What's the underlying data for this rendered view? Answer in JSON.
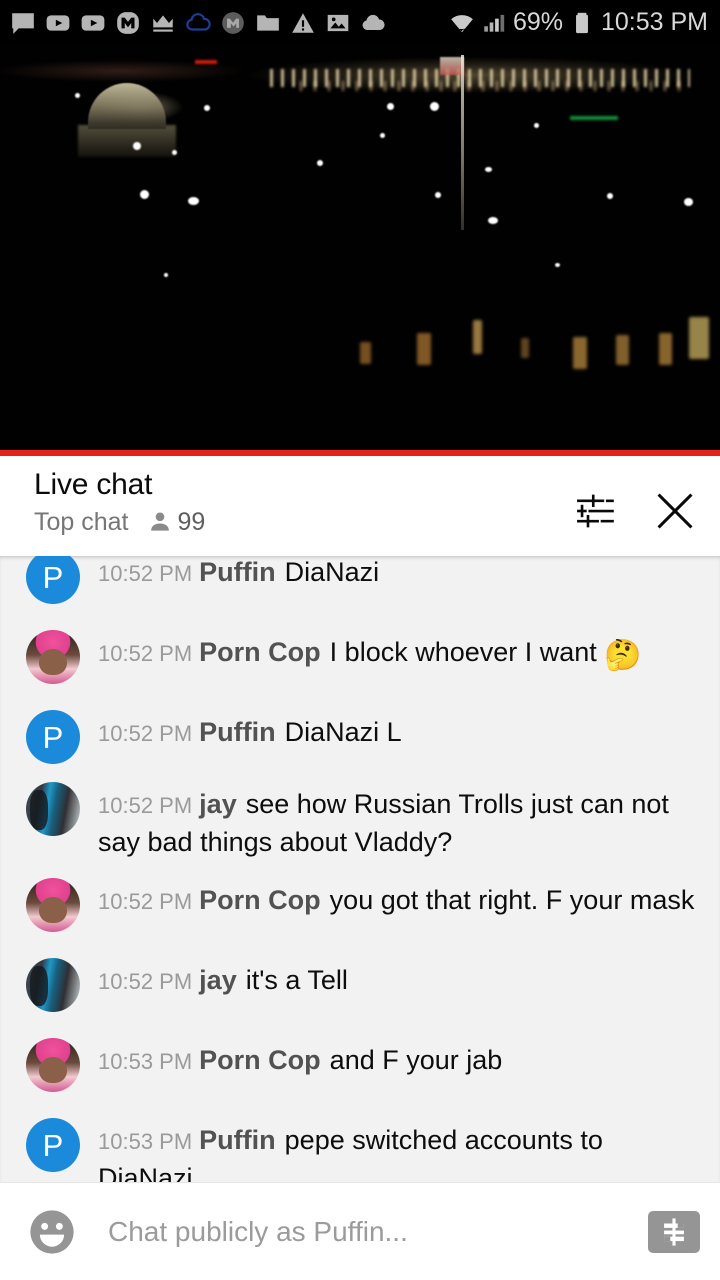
{
  "status_bar": {
    "icons": [
      "message-icon",
      "youtube-icon",
      "youtube-icon",
      "monero-icon",
      "crown-icon",
      "cloud-outline-icon",
      "monero-circle-icon",
      "folder-icon",
      "warning-triangle-icon",
      "image-icon",
      "cloud-filled-icon"
    ],
    "right_icons": [
      "wifi-icon",
      "cell-signal-icon",
      "battery-icon"
    ],
    "battery_percent": "69%",
    "clock": "10:53 PM"
  },
  "video": {
    "progress_color": "#e62117"
  },
  "chat_header": {
    "title": "Live chat",
    "subtitle": "Top chat",
    "viewer_count": "99",
    "viewer_icon": "person-icon",
    "tune_icon": "tune-icon",
    "close_icon": "close-icon"
  },
  "messages": [
    {
      "timestamp": "10:52 PM",
      "author": "Puffin",
      "text": "DiaNazi",
      "avatar_type": "letter",
      "avatar_letter": "P",
      "avatar_color": "#1c8adb",
      "emoji": ""
    },
    {
      "timestamp": "10:52 PM",
      "author": "Porn Cop",
      "text": "I block whoever I want",
      "avatar_type": "photo-porncop",
      "avatar_letter": "",
      "avatar_color": "",
      "emoji": "🤔"
    },
    {
      "timestamp": "10:52 PM",
      "author": "Puffin",
      "text": "DiaNazi L",
      "avatar_type": "letter",
      "avatar_letter": "P",
      "avatar_color": "#1c8adb",
      "emoji": ""
    },
    {
      "timestamp": "10:52 PM",
      "author": "jay",
      "text": "see how Russian Trolls just can not say bad things about Vladdy?",
      "avatar_type": "photo-jay",
      "avatar_letter": "",
      "avatar_color": "",
      "emoji": ""
    },
    {
      "timestamp": "10:52 PM",
      "author": "Porn Cop",
      "text": "you got that right. F your mask",
      "avatar_type": "photo-porncop",
      "avatar_letter": "",
      "avatar_color": "",
      "emoji": ""
    },
    {
      "timestamp": "10:52 PM",
      "author": "jay",
      "text": "it's a Tell",
      "avatar_type": "photo-jay",
      "avatar_letter": "",
      "avatar_color": "",
      "emoji": ""
    },
    {
      "timestamp": "10:53 PM",
      "author": "Porn Cop",
      "text": "and F your jab",
      "avatar_type": "photo-porncop",
      "avatar_letter": "",
      "avatar_color": "",
      "emoji": ""
    },
    {
      "timestamp": "10:53 PM",
      "author": "Puffin",
      "text": "pepe switched accounts to DiaNazi",
      "avatar_type": "letter",
      "avatar_letter": "P",
      "avatar_color": "#1c8adb",
      "emoji": ""
    }
  ],
  "input_bar": {
    "emoji_icon": "smiley-icon",
    "placeholder": "Chat publicly as Puffin...",
    "superchat_icon": "dollar-icon"
  }
}
